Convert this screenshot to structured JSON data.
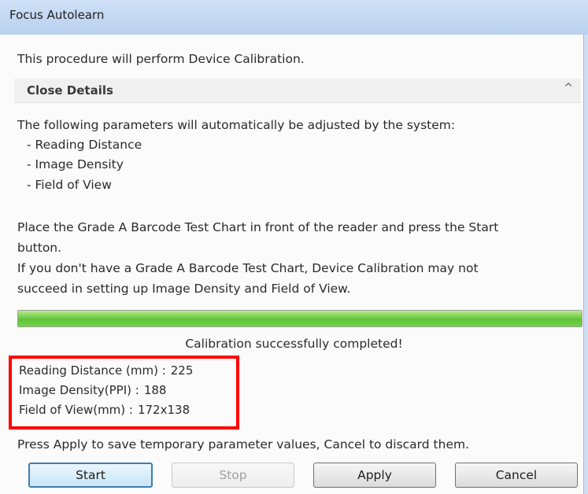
{
  "window": {
    "title": "Focus Autolearn"
  },
  "intro": "This procedure will perform Device Calibration.",
  "details": {
    "label": "Close Details",
    "chevron": "^"
  },
  "params_intro": "The following parameters will automatically be adjusted by the system:",
  "params_list": [
    "- Reading Distance",
    "- Image Density",
    "- Field of View"
  ],
  "instructions": [
    "Place the Grade A Barcode Test Chart in front of the reader and press the Start",
    "button.",
    "If you don't have a Grade A Barcode Test Chart, Device Calibration may not",
    "succeed in setting up Image Density and Field of View."
  ],
  "progress": {
    "percent": 100
  },
  "status": "Calibration successfully completed!",
  "results": {
    "reading_distance": {
      "label": "Reading Distance (mm) :",
      "value": "225"
    },
    "image_density": {
      "label": "Image Density(PPI) :",
      "value": "188"
    },
    "field_of_view": {
      "label": "Field of View(mm) :",
      "value": "172x138"
    }
  },
  "footer_text": "Press Apply to save temporary parameter values, Cancel to discard them.",
  "buttons": {
    "start": "Start",
    "stop": "Stop",
    "apply": "Apply",
    "cancel": "Cancel"
  },
  "colors": {
    "highlight": "#ff0000",
    "progress": "#5fc33a",
    "titlebar": "#c7dbf3"
  }
}
